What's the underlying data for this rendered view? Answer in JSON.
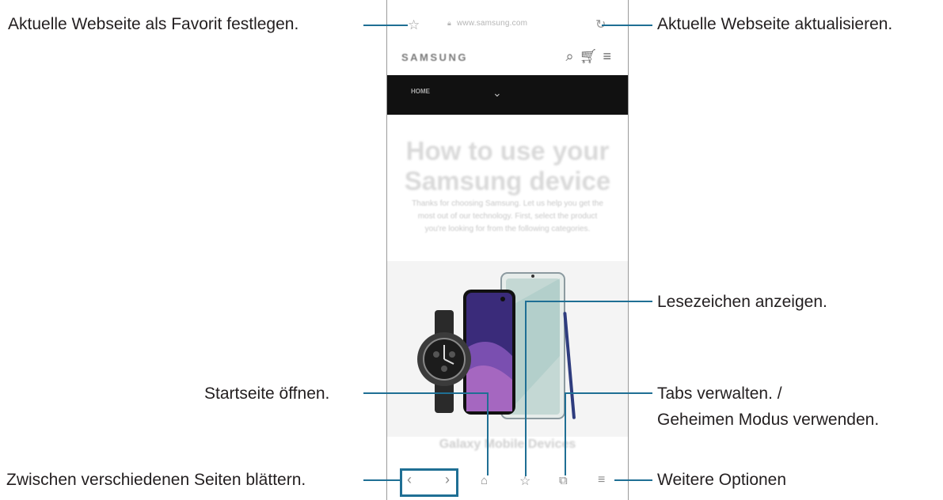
{
  "callouts": {
    "favorite": "Aktuelle Webseite als Favorit festlegen.",
    "reload": "Aktuelle Webseite aktualisieren.",
    "bookmarks": "Lesezeichen anzeigen.",
    "home": "Startseite öffnen.",
    "tabs_line1": "Tabs verwalten. /",
    "tabs_line2": "Geheimen Modus verwenden.",
    "navigate": "Zwischen verschiedenen Seiten blättern.",
    "more": "Weitere Optionen"
  },
  "browser": {
    "url": "www.samsung.com",
    "brand": "SAMSUNG",
    "nav_label": "HOME",
    "headline": "How to use your Samsung device",
    "subtext": "Thanks for choosing Samsung. Let us help you get the most out of our technology. First, select the product you're looking for from the following categories.",
    "footer_title": "Galaxy Mobile Devices"
  },
  "icons": {
    "star": "star-icon",
    "reload": "reload-icon",
    "lock": "lock-icon",
    "search": "search-icon",
    "cart": "cart-icon",
    "menu": "menu-icon",
    "back": "back-icon",
    "forward": "forward-icon",
    "home": "home-icon",
    "bookmarks": "bookmarks-icon",
    "tabs": "tabs-icon",
    "more": "more-options-icon"
  },
  "colors": {
    "callout_line": "#1f6f94",
    "text": "#231f20",
    "nav_bar": "#111111"
  }
}
